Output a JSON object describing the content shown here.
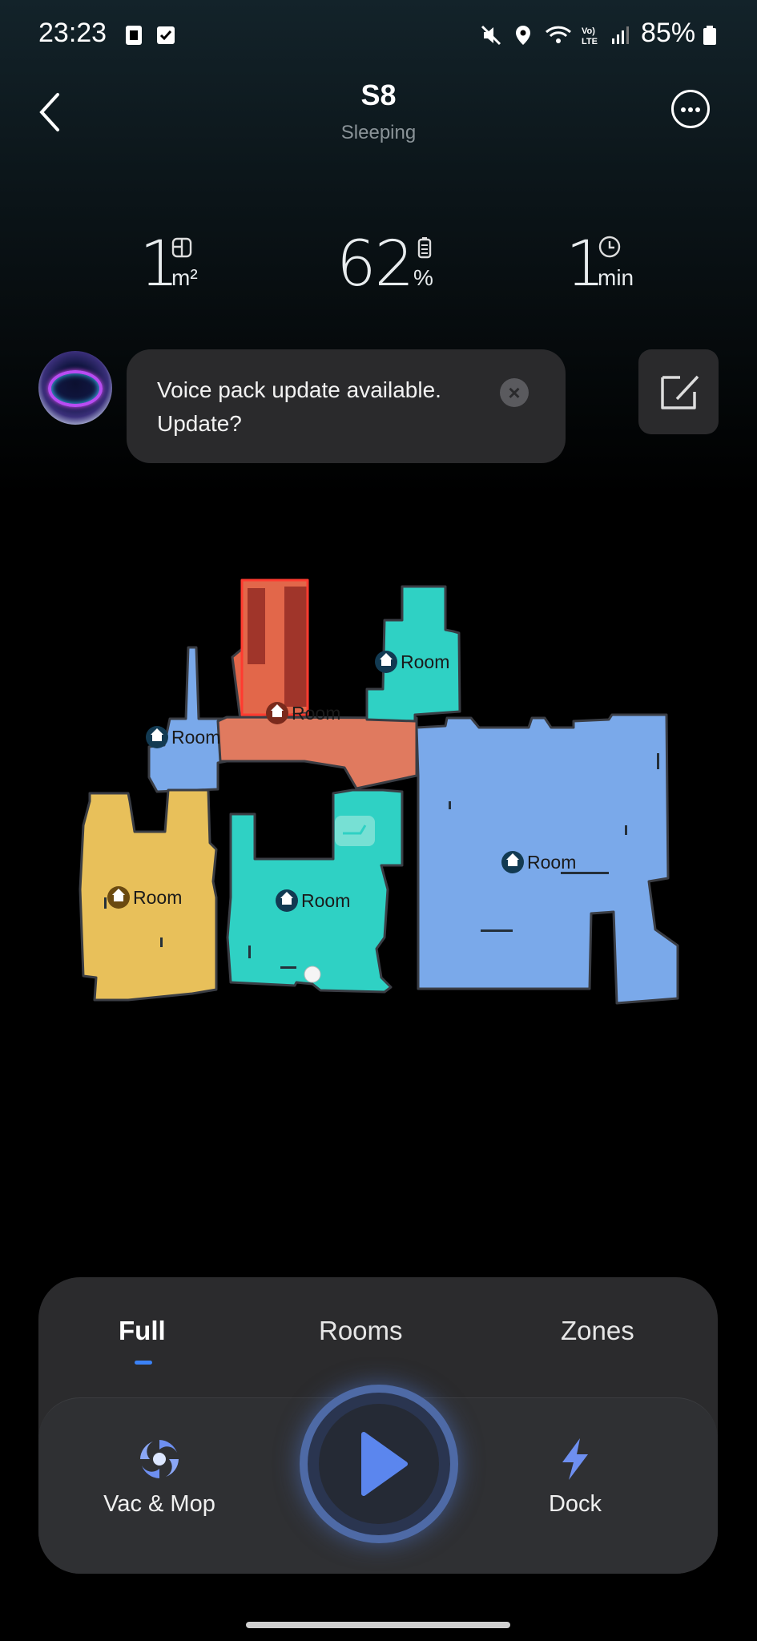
{
  "status_bar": {
    "time": "23:23",
    "battery": "85%",
    "icons": [
      "sim-card-icon",
      "checkbox-icon",
      "mute-icon",
      "location-icon",
      "wifi-icon",
      "volte-icon",
      "signal-icon",
      "battery-icon"
    ]
  },
  "header": {
    "title": "S8",
    "subtitle": "Sleeping"
  },
  "stats": {
    "area": {
      "value": "1",
      "unit": "m²",
      "icon": "area-icon"
    },
    "battery": {
      "value": "62",
      "unit": "%",
      "icon": "battery-icon"
    },
    "time": {
      "value": "1",
      "unit": "min",
      "icon": "clock-icon"
    }
  },
  "notice": {
    "text": "Voice pack update available. Update?",
    "close": "×"
  },
  "map": {
    "room_label": "Room",
    "colors": {
      "blue": "#7aa9ea",
      "salmon": "#e07a5f",
      "red": "#e2674a",
      "teal": "#2fd1c4",
      "yellow": "#e8c05a"
    }
  },
  "controls": {
    "tabs": [
      {
        "label": "Full",
        "active": true
      },
      {
        "label": "Rooms",
        "active": false
      },
      {
        "label": "Zones",
        "active": false
      }
    ],
    "mode_label": "Vac & Mop",
    "dock_label": "Dock",
    "accent": "#3b82f6"
  }
}
